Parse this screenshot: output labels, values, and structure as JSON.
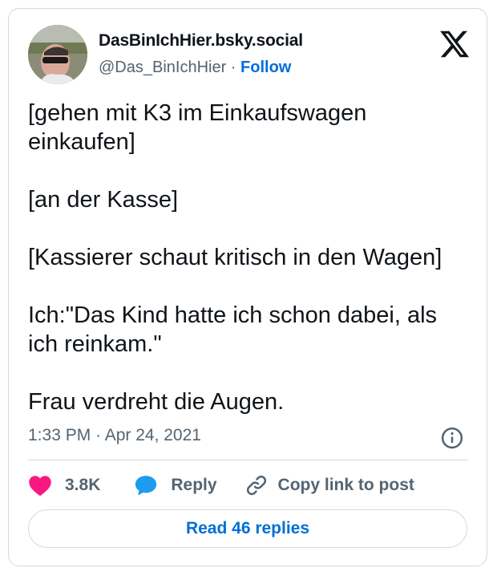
{
  "author": {
    "display_name": "DasBinIchHier.bsky.social",
    "handle": "@Das_BinIchHier",
    "separator": " · ",
    "follow_label": "Follow"
  },
  "tweet": {
    "paragraphs": [
      "[gehen mit K3 im Einkaufswagen einkaufen]",
      "[an der Kasse]",
      "[Kassierer schaut kritisch in den Wagen]",
      "Ich:\"Das Kind hatte ich schon dabei, als ich reinkam.\"",
      "Frau verdreht die Augen."
    ],
    "timestamp": "1:33 PM · Apr 24, 2021"
  },
  "actions": {
    "likes_count": "3.8K",
    "reply_label": "Reply",
    "copy_link_label": "Copy link to post"
  },
  "read_replies_label": "Read 46 replies",
  "colors": {
    "like_heart": "#f91880",
    "reply_bubble": "#1d9bf0",
    "link_blue": "#006fd6",
    "muted_text": "#536471"
  },
  "icons": [
    "x-logo-icon",
    "info-icon",
    "heart-icon",
    "reply-bubble-icon",
    "link-icon"
  ]
}
